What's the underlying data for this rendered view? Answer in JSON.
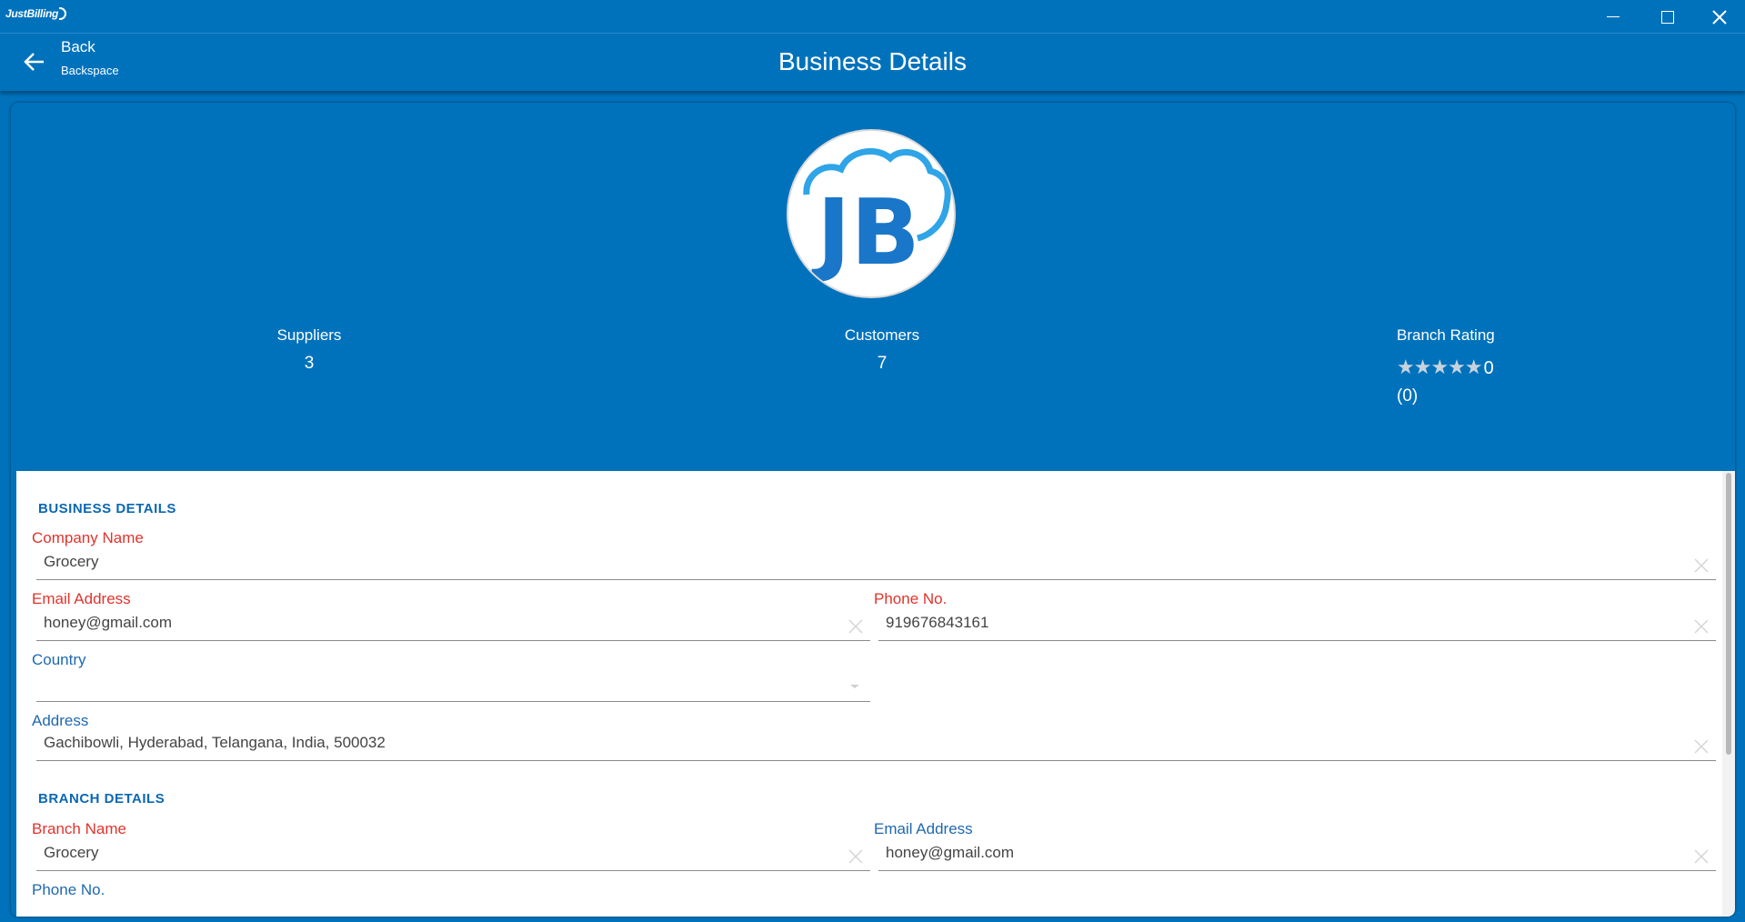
{
  "window": {
    "app_name": "JustBilling"
  },
  "header": {
    "back_label": "Back",
    "back_hint": "Backspace",
    "title": "Business Details"
  },
  "profile": {
    "logo_text": "JB",
    "stats": {
      "suppliers_label": "Suppliers",
      "suppliers_value": "3",
      "customers_label": "Customers",
      "customers_value": "7",
      "rating_label": "Branch Rating",
      "rating_stars": "★★★★★",
      "rating_value": "0",
      "rating_count": "(0)"
    }
  },
  "business": {
    "section_title": "BUSINESS DETAILS",
    "company_name_label": "Company Name",
    "company_name_value": "Grocery",
    "email_label": "Email Address",
    "email_value": "honey@gmail.com",
    "phone_label": "Phone No.",
    "phone_value": "919676843161",
    "country_label": "Country",
    "country_value": "",
    "address_label": "Address",
    "address_value": "Gachibowli, Hyderabad, Telangana, India, 500032"
  },
  "branch": {
    "section_title": "BRANCH DETAILS",
    "branch_name_label": "Branch Name",
    "branch_name_value": "Grocery",
    "email_label": "Email Address",
    "email_value": "honey@gmail.com",
    "phone_label": "Phone No."
  },
  "colors": {
    "brand_blue": "#0072bc",
    "required_label": "#e2332d",
    "label_blue": "#1f68b0"
  }
}
